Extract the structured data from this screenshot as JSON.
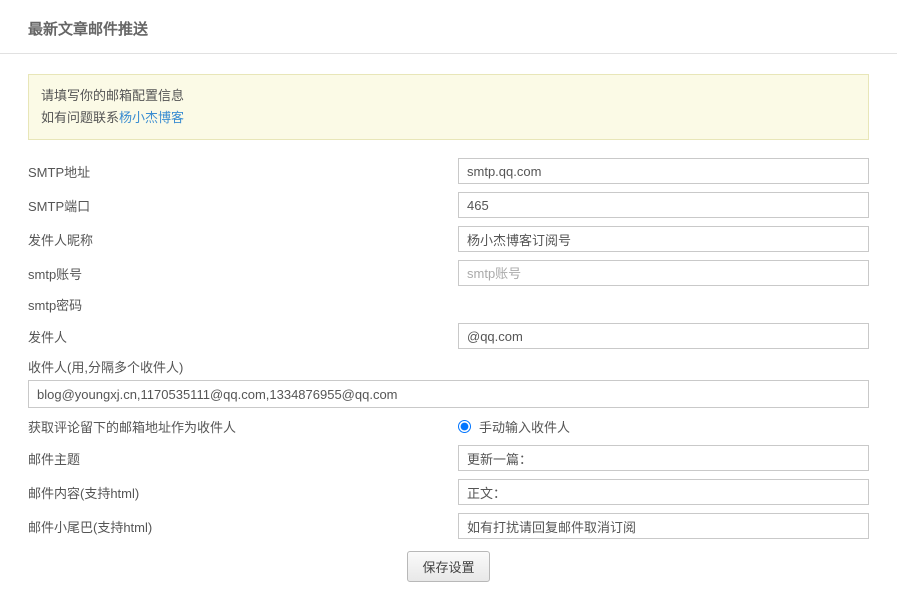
{
  "page_title": "最新文章邮件推送",
  "notice": {
    "line1": "请填写你的邮箱配置信息",
    "line2_prefix": "如有问题联系",
    "line2_link": "杨小杰博客"
  },
  "fields": {
    "smtp_addr": {
      "label": "SMTP地址",
      "value": "smtp.qq.com",
      "placeholder": ""
    },
    "smtp_port": {
      "label": "SMTP端口",
      "value": "465",
      "placeholder": ""
    },
    "sender_nick": {
      "label": "发件人昵称",
      "value": "杨小杰博客订阅号",
      "placeholder": ""
    },
    "smtp_user": {
      "label": "smtp账号",
      "value": "",
      "placeholder": "smtp账号"
    },
    "smtp_pass": {
      "label": "smtp密码",
      "value": "",
      "placeholder": ""
    },
    "sender": {
      "label": "发件人",
      "value": "@qq.com",
      "placeholder": ""
    },
    "recipients": {
      "label": "收件人(用,分隔多个收件人)",
      "value": "blog@youngxj.cn,1170535111@qq.com,1334876955@qq.com"
    },
    "recip_mode": {
      "label": "获取评论留下的邮箱地址作为收件人",
      "radio_label": "手动输入收件人"
    },
    "subject": {
      "label": "邮件主题",
      "value": "更新一篇："
    },
    "body": {
      "label": "邮件内容(支持html)",
      "value": "正文："
    },
    "footer": {
      "label": "邮件小尾巴(支持html)",
      "value": "如有打扰请回复邮件取消订阅"
    }
  },
  "submit_label": "保存设置"
}
